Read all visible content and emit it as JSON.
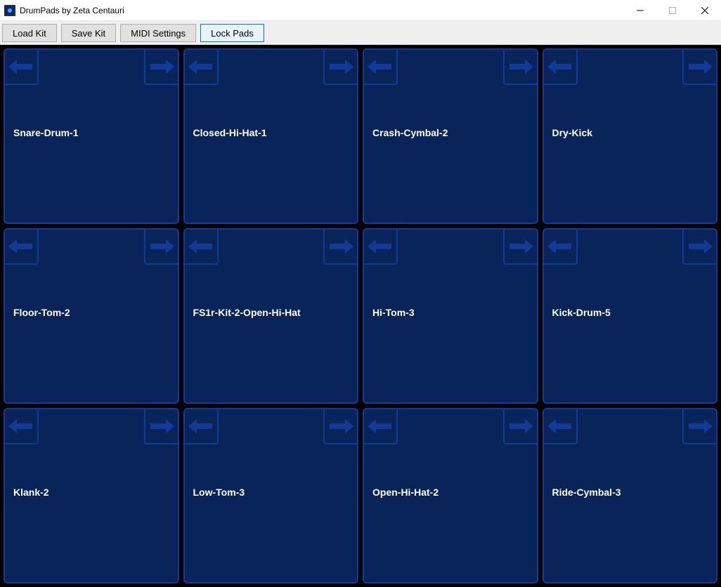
{
  "window": {
    "title": "DrumPads by Zeta Centauri"
  },
  "toolbar": {
    "load_kit": "Load Kit",
    "save_kit": "Save Kit",
    "midi_settings": "MIDI Settings",
    "lock_pads": "Lock Pads"
  },
  "pads": [
    {
      "label": "Snare-Drum-1"
    },
    {
      "label": "Closed-Hi-Hat-1"
    },
    {
      "label": "Crash-Cymbal-2"
    },
    {
      "label": "Dry-Kick"
    },
    {
      "label": "Floor-Tom-2"
    },
    {
      "label": "FS1r-Kit-2-Open-Hi-Hat"
    },
    {
      "label": "Hi-Tom-3"
    },
    {
      "label": "Kick-Drum-5"
    },
    {
      "label": "Klank-2"
    },
    {
      "label": "Low-Tom-3"
    },
    {
      "label": "Open-Hi-Hat-2"
    },
    {
      "label": "Ride-Cymbal-3"
    }
  ]
}
